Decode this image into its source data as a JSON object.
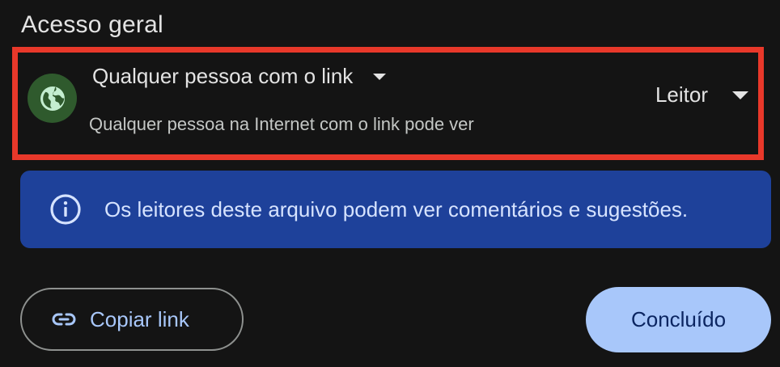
{
  "general_access": {
    "title": "Acesso geral",
    "access_type": "Qualquer pessoa com o link",
    "access_description": "Qualquer pessoa na Internet com o link pode ver",
    "role": "Leitor",
    "icon": "globe-icon"
  },
  "info_banner": {
    "icon": "info-icon",
    "text": "Os leitores deste arquivo podem ver comentários e sugestões."
  },
  "actions": {
    "copy_link_label": "Copiar link",
    "copy_link_icon": "link-icon",
    "done_label": "Concluído"
  },
  "colors": {
    "highlight_border": "#e8382a",
    "banner_background": "#1e419a",
    "primary_button": "#a8c7fa",
    "globe_background": "#2f5a2d"
  }
}
